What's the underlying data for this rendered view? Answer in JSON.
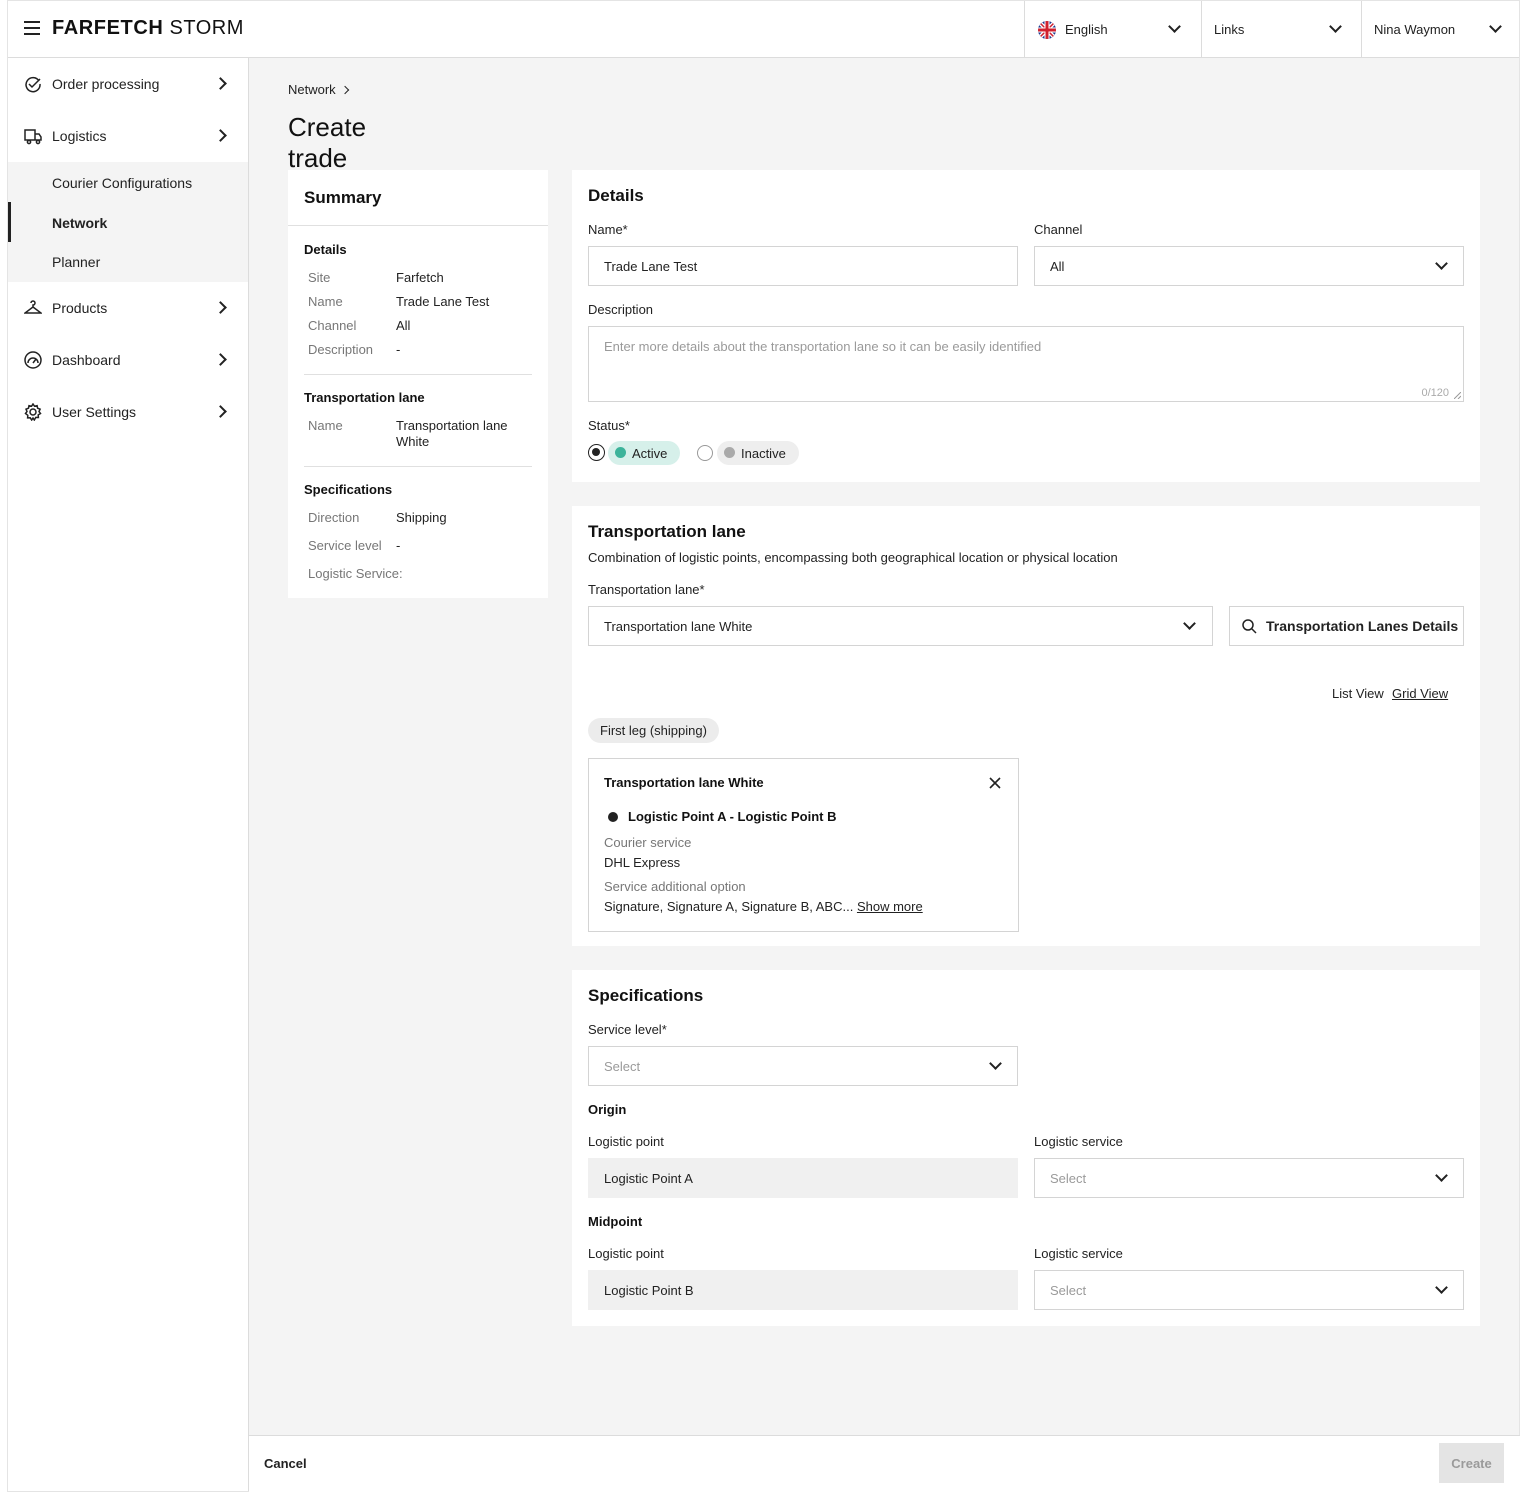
{
  "header": {
    "brand_bold": "FARFETCH",
    "brand_light": "STORM",
    "language": "English",
    "links": "Links",
    "user": "Nina Waymon"
  },
  "sidebar": {
    "items": [
      {
        "label": "Order processing",
        "icon": "order-processing-icon"
      },
      {
        "label": "Logistics",
        "icon": "truck-icon"
      },
      {
        "label": "Products",
        "icon": "hanger-icon"
      },
      {
        "label": "Dashboard",
        "icon": "gauge-icon"
      },
      {
        "label": "User Settings",
        "icon": "gear-icon"
      }
    ],
    "sub_items": [
      "Courier Configurations",
      "Network",
      "Planner"
    ],
    "active_sub": "Network"
  },
  "breadcrumb": {
    "item": "Network"
  },
  "page_title": "Create trade lane",
  "summary": {
    "title": "Summary",
    "details_heading": "Details",
    "details": [
      {
        "k": "Site",
        "v": "Farfetch"
      },
      {
        "k": "Name",
        "v": "Trade Lane Test"
      },
      {
        "k": "Channel",
        "v": "All"
      },
      {
        "k": "Description",
        "v": "-"
      }
    ],
    "tl_heading": "Transportation lane",
    "tl": {
      "k": "Name",
      "v": "Transportation lane White"
    },
    "spec_heading": "Specifications",
    "spec": [
      {
        "k": "Direction",
        "v": "Shipping"
      },
      {
        "k": "Service level",
        "v": "-"
      },
      {
        "k": "Logistic Service:",
        "v": ""
      }
    ]
  },
  "details": {
    "title": "Details",
    "name_label": "Name*",
    "name_value": "Trade Lane Test",
    "channel_label": "Channel",
    "channel_value": "All",
    "desc_label": "Description",
    "desc_placeholder": "Enter more details about the transportation lane so it can be easily identified",
    "desc_counter": "0/120",
    "status_label": "Status*",
    "status_active": "Active",
    "status_inactive": "Inactive",
    "status_selected": "Active"
  },
  "transport": {
    "title": "Transportation lane",
    "subtitle": "Combination of logistic points, encompassing both geographical location or physical location",
    "field_label": "Transportation lane*",
    "field_value": "Transportation lane White",
    "details_button": "Transportation Lanes Details",
    "list_view": "List View",
    "grid_view": "Grid View",
    "leg_chip": "First leg (shipping)",
    "lane_card": {
      "title": "Transportation lane White",
      "route": "Logistic Point A - Logistic Point B",
      "courier_label": "Courier service",
      "courier_value": "DHL Express",
      "option_label": "Service additional option",
      "option_value": "Signature, Signature A, Signature B, ABC...",
      "show_more": "Show more"
    }
  },
  "specs": {
    "title": "Specifications",
    "service_level_label": "Service level*",
    "service_level_placeholder": "Select",
    "origin_heading": "Origin",
    "origin_lp_label": "Logistic point",
    "origin_lp_value": "Logistic Point A",
    "origin_ls_label": "Logistic service",
    "origin_ls_placeholder": "Select",
    "mid_heading": "Midpoint",
    "mid_lp_label": "Logistic point",
    "mid_lp_value": "Logistic Point B",
    "mid_ls_label": "Logistic service",
    "mid_ls_placeholder": "Select"
  },
  "footer": {
    "cancel": "Cancel",
    "create": "Create"
  },
  "colors": {
    "active_chip": "#d6f0ea",
    "active_dot": "#3cb39a",
    "inactive_chip": "#eeeeee",
    "inactive_dot": "#aaaaaa"
  }
}
